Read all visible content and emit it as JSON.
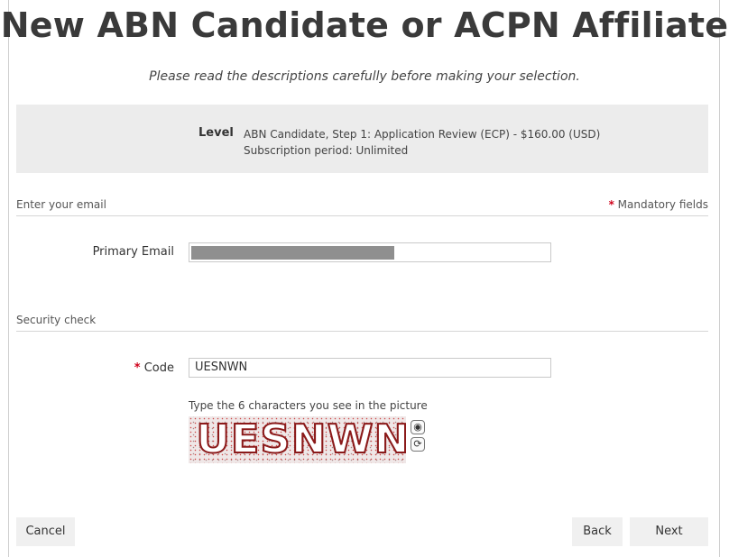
{
  "header": {
    "title": "New ABN Candidate or ACPN Affiliate",
    "subtitle": "Please read the descriptions carefully before making your selection."
  },
  "level": {
    "label": "Level",
    "name": "ABN Candidate, Step 1: Application Review (ECP) - $160.00 (USD)",
    "subscription": "Subscription period: Unlimited"
  },
  "email_section": {
    "heading": "Enter your email",
    "mandatory_star": "*",
    "mandatory_text": "Mandatory fields",
    "primary_email_label": "Primary Email"
  },
  "security_section": {
    "heading": "Security check",
    "code_star": "*",
    "code_label": "Code",
    "code_value": "UESNWN",
    "hint": "Type the 6 characters you see in the picture",
    "captcha_text": "UESNWN"
  },
  "buttons": {
    "cancel": "Cancel",
    "back": "Back",
    "next": "Next"
  },
  "colors": {
    "required_star": "#d0021b",
    "level_box_bg": "#ececec",
    "button_bg": "#f0f0f0"
  }
}
